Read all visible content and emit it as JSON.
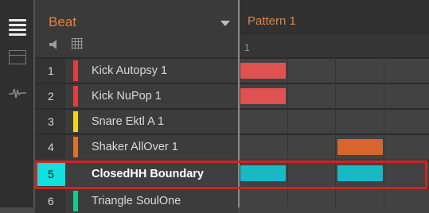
{
  "group": {
    "name": "Beat"
  },
  "pattern": {
    "name": "Pattern 1",
    "bar_number": "1"
  },
  "toolbar": {
    "list_icon": "list-view-icon",
    "grid_icon": "arranger-view-icon",
    "wave_icon": "waveform-icon"
  },
  "header_icons": {
    "speaker_icon": "speaker-icon",
    "grid_icon": "grid-icon"
  },
  "sounds": [
    {
      "number": "1",
      "name": "Kick Autopsy 1",
      "color": "#e0403a"
    },
    {
      "number": "2",
      "name": "Kick NuPop 1",
      "color": "#e0403a"
    },
    {
      "number": "3",
      "name": "Snare Ektl A 1",
      "color": "#f2d21a"
    },
    {
      "number": "4",
      "name": "Shaker AllOver 1",
      "color": "#e07030"
    },
    {
      "number": "5",
      "name": "ClosedHH Boundary",
      "color": "#0fe0e0",
      "selected": true
    },
    {
      "number": "6",
      "name": "Triangle SoulOne",
      "color": "#18c98e"
    }
  ],
  "colors": {
    "accent": "#e6813a",
    "selection_frame": "#cc2424",
    "selected_slot": "#0fe0e0"
  }
}
